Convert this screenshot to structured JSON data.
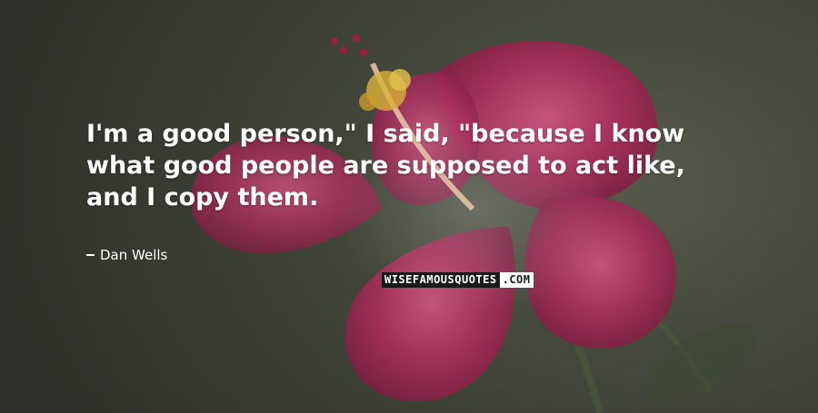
{
  "quote": {
    "text": "I'm a good person,\" I said, \"because I know what good people are supposed to act like, and I copy them."
  },
  "author": {
    "name": "Dan Wells"
  },
  "watermark": {
    "brand": "WISEFAMOUSQUOTES",
    "extension": ".COM"
  },
  "colors": {
    "background": "#3e4237",
    "petal": "#b2305f",
    "pollen": "#d9b23a",
    "text": "#ffffff"
  }
}
